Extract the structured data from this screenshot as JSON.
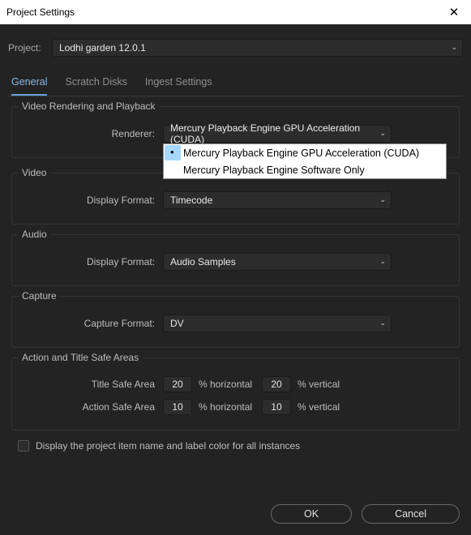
{
  "window": {
    "title": "Project Settings",
    "close_glyph": "✕"
  },
  "project": {
    "label": "Project:",
    "value": "Lodhi garden 12.0.1"
  },
  "tabs": [
    {
      "label": "General"
    },
    {
      "label": "Scratch Disks"
    },
    {
      "label": "Ingest Settings"
    }
  ],
  "groups": {
    "vr_playback": {
      "legend": "Video Rendering and Playback",
      "renderer_label": "Renderer:",
      "renderer_value": "Mercury Playback Engine GPU Acceleration (CUDA)",
      "renderer_options": [
        "Mercury Playback Engine GPU Acceleration (CUDA)",
        "Mercury Playback Engine Software Only"
      ]
    },
    "video": {
      "legend": "Video",
      "display_format_label": "Display Format:",
      "display_format_value": "Timecode"
    },
    "audio": {
      "legend": "Audio",
      "display_format_label": "Display Format:",
      "display_format_value": "Audio Samples"
    },
    "capture": {
      "legend": "Capture",
      "capture_format_label": "Capture Format:",
      "capture_format_value": "DV"
    },
    "safe": {
      "legend": "Action and Title Safe Areas",
      "title_safe_label": "Title Safe Area",
      "title_safe_h": "20",
      "title_safe_v": "20",
      "action_safe_label": "Action Safe Area",
      "action_safe_h": "10",
      "action_safe_v": "10",
      "pct_h": "% horizontal",
      "pct_v": "% vertical"
    }
  },
  "display_checkbox": {
    "label": "Display the project item name and label color for all instances"
  },
  "buttons": {
    "ok": "OK",
    "cancel": "Cancel"
  },
  "glyphs": {
    "chevron": "⌄"
  }
}
